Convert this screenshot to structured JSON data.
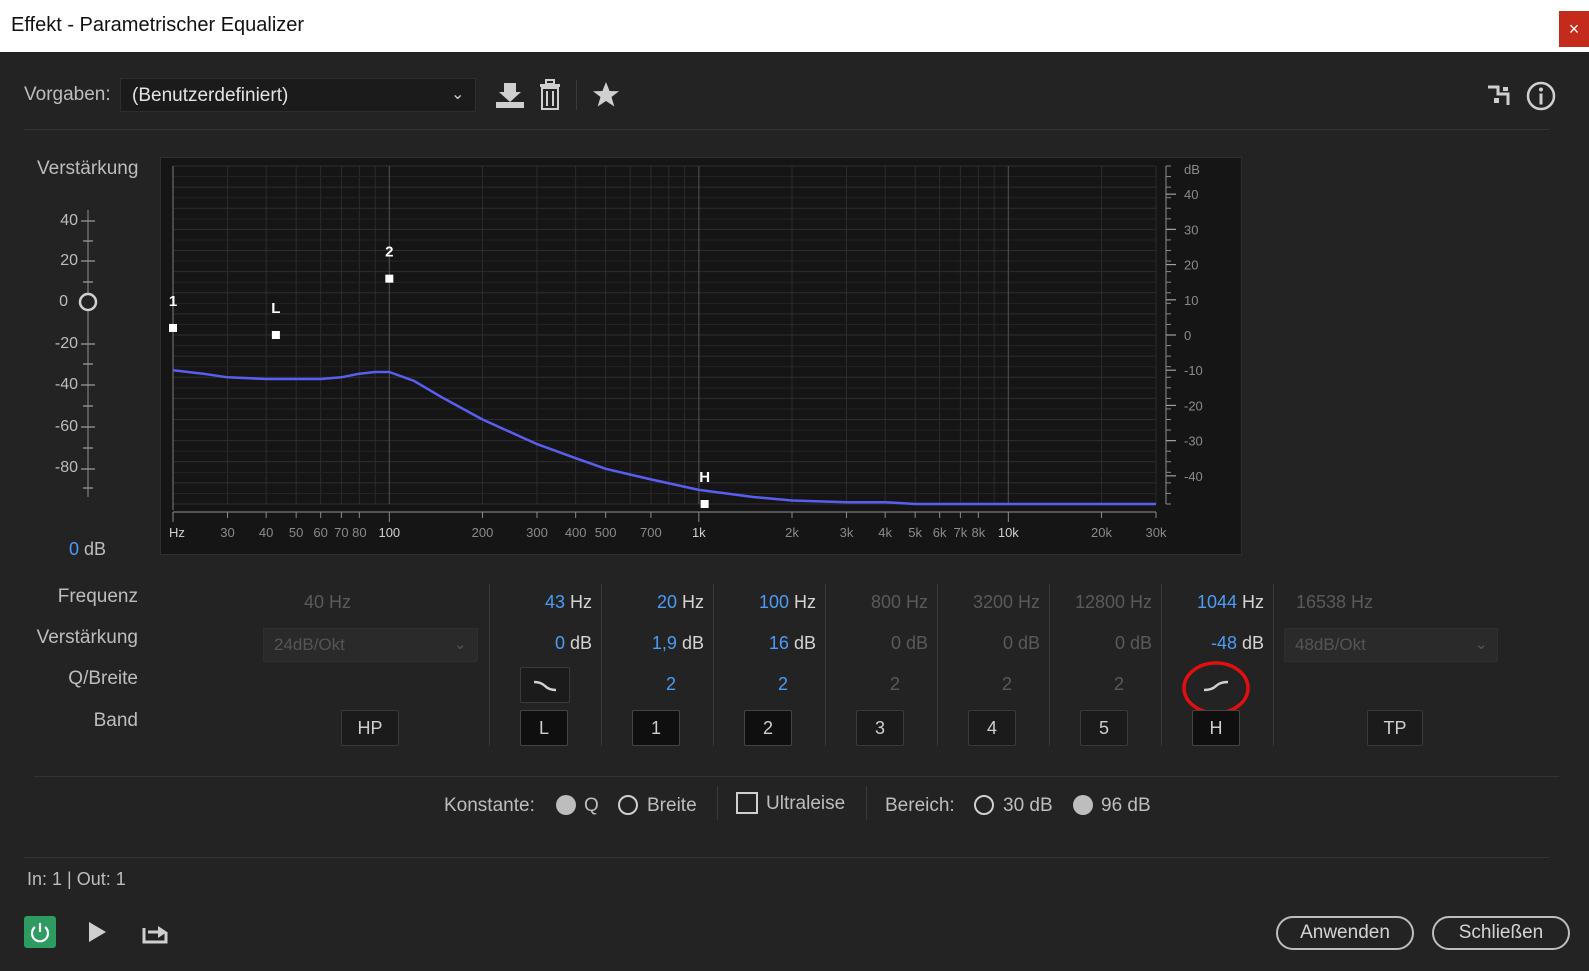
{
  "window": {
    "title": "Effekt - Parametrischer Equalizer",
    "close_glyph": "×"
  },
  "toolbar": {
    "preset_label": "Vorgaben:",
    "preset_value": "(Benutzerdefiniert)",
    "icons": [
      "download-icon",
      "trash-icon",
      "star-icon",
      "routing-icon",
      "info-icon"
    ]
  },
  "gain": {
    "label": "Verstärkung",
    "scale": [
      "40",
      "20",
      "0",
      "-20",
      "-40",
      "-60",
      "-80"
    ],
    "readout_value": "0",
    "readout_unit": "dB",
    "slider_value_db": 0
  },
  "chart_data": {
    "type": "line",
    "x_scale": "log",
    "x_ticks": [
      "Hz",
      "30",
      "40",
      "50",
      "60",
      "70",
      "80",
      "100",
      "200",
      "300",
      "400",
      "500",
      "700",
      "1k",
      "2k",
      "3k",
      "4k",
      "5k",
      "6k",
      "7k",
      "8k",
      "10k",
      "20k",
      "30k"
    ],
    "y_label": "dB",
    "y_ticks": [
      "40",
      "30",
      "20",
      "10",
      "0",
      "-10",
      "-20",
      "-30",
      "-40"
    ],
    "ylim": [
      -48,
      48
    ],
    "grid": true,
    "curve": {
      "x": [
        20,
        25,
        30,
        40,
        50,
        60,
        70,
        80,
        90,
        100,
        120,
        150,
        200,
        300,
        400,
        500,
        700,
        1000,
        1500,
        2000,
        3000,
        4000,
        5000,
        10000,
        20000,
        30000
      ],
      "y": [
        -10,
        -11,
        -12,
        -12.5,
        -12.5,
        -12.5,
        -12,
        -11,
        -10.5,
        -10.5,
        -13,
        -18,
        -24,
        -31,
        -35,
        -38,
        -41,
        -44,
        -46,
        -47,
        -47.5,
        -47.5,
        -48,
        -48,
        -48,
        -48
      ]
    },
    "handles": [
      {
        "label": "1",
        "freq": 20,
        "gain": 2
      },
      {
        "label": "L",
        "freq": 43,
        "gain": 0
      },
      {
        "label": "2",
        "freq": 100,
        "gain": 16
      },
      {
        "label": "H",
        "freq": 1044,
        "gain": -48
      }
    ]
  },
  "params": {
    "labels": {
      "freq": "Frequenz",
      "gain": "Verstärkung",
      "q": "Q/Breite",
      "band": "Band"
    },
    "hp": {
      "freq": "40 Hz",
      "slope": "24dB/Okt",
      "band": "HP"
    },
    "tp": {
      "freq": "16538 Hz",
      "slope": "48dB/Okt",
      "band": "TP"
    },
    "bands": [
      {
        "band": "L",
        "freq": "43",
        "freq_unit": "Hz",
        "gain": "0",
        "gain_unit": "dB",
        "q_icon": "low-shelf-icon"
      },
      {
        "band": "1",
        "freq": "20",
        "freq_unit": "Hz",
        "gain": "1,9",
        "gain_unit": "dB",
        "q": "2"
      },
      {
        "band": "2",
        "freq": "100",
        "freq_unit": "Hz",
        "gain": "16",
        "gain_unit": "dB",
        "q": "2"
      },
      {
        "band": "3",
        "freq": "800 Hz",
        "gain": "0 dB",
        "q": "2"
      },
      {
        "band": "4",
        "freq": "3200 Hz",
        "gain": "0 dB",
        "q": "2"
      },
      {
        "band": "5",
        "freq": "12800 Hz",
        "gain": "0 dB",
        "q": "2"
      },
      {
        "band": "H",
        "freq": "1044",
        "freq_unit": "Hz",
        "gain": "-48",
        "gain_unit": "dB",
        "q_icon": "high-shelf-icon"
      }
    ]
  },
  "options": {
    "constant_label": "Konstante:",
    "q_label": "Q",
    "width_label": "Breite",
    "constant_selected": "Q",
    "ultraquiet_label": "Ultraleise",
    "ultraquiet_checked": false,
    "range_label": "Bereich:",
    "range_30": "30 dB",
    "range_96": "96 dB",
    "range_selected": "96 dB"
  },
  "footer": {
    "io_status": "In: 1 | Out: 1",
    "apply_label": "Anwenden",
    "close_label": "Schließen"
  },
  "colors": {
    "curve": "#5a5ef0",
    "accent_value": "#4b9cf6",
    "power_on": "#2e9b62",
    "annotation": "#e01010"
  }
}
